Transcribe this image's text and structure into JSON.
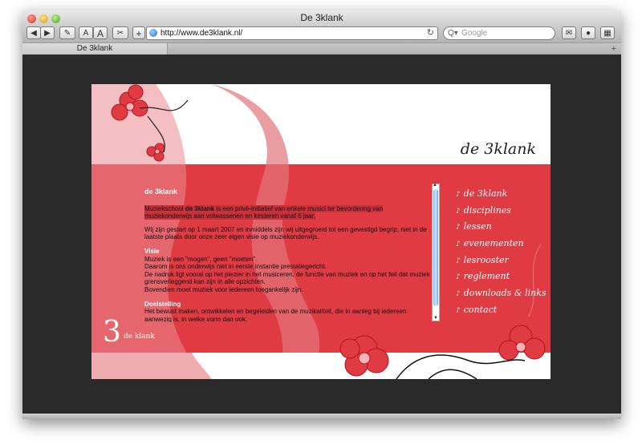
{
  "window": {
    "title": "De 3klank"
  },
  "toolbar": {
    "back_icon": "◀",
    "forward_icon": "▶",
    "edit_icon": "✎",
    "text_small": "A",
    "text_large": "A",
    "snippet_icon": "✂",
    "add_bookmark": "+",
    "url": "http://www.de3klank.nl/",
    "reload_icon": "↻",
    "search_placeholder": "Google",
    "search_icon": "Q▾",
    "mail_icon": "✉",
    "record_icon": "●",
    "bookmarks_icon": "▦"
  },
  "tabs": [
    {
      "label": "De 3klank"
    }
  ],
  "tab_add": "+",
  "site": {
    "brand": "de 3klank",
    "logo_number": "3",
    "logo_word": "de klank",
    "content": {
      "heading": "de 3klank",
      "intro_prefix": "Muziekschool ",
      "intro_bold": "de 3klank",
      "intro_rest": " is een privé-initiatief van enkele musici ter bevordering van muziekonderwijs aan volwassenen en kinderen vanaf 6 jaar.",
      "history": "Wij zijn gestart op 1 maart 2007 en inmiddels zijn wij uitgegroeid tot een gevestigd begrip, niet in de laatste plaats door onze zeer eigen visie op muziekonderwijs.",
      "visie_heading": "Visie",
      "visie_lines": [
        "Muziek is een \"mogen\", geen \"moeten\".",
        "Daarom is ons onderwijs niet in eerste instantie prestatiegericht.",
        "De nadruk ligt vooral op het plezier in het musiceren, de functie van muziek en op het feit dat muziek grensverleggend kan zijn in alle opzichten.",
        "Bovendien moet muziek voor iedereen toegankelijk zijn."
      ],
      "doel_heading": "Doelstelling",
      "doel_text": "Het bewust maken, ontwikkelen en begeleiden van de muzikaliteit, die in aanleg bij iedereen aanwezig is, in welke vorm dan ook."
    },
    "nav": [
      {
        "label": "de 3klank"
      },
      {
        "label": "disciplines"
      },
      {
        "label": "lessen"
      },
      {
        "label": "evenementen"
      },
      {
        "label": "lesrooster"
      },
      {
        "label": "reglement"
      },
      {
        "label": "downloads & links"
      },
      {
        "label": "contact"
      }
    ],
    "nav_icon": "♪"
  },
  "colors": {
    "brand_red": "#e03a43",
    "frame_dark": "#2a2a2a"
  }
}
